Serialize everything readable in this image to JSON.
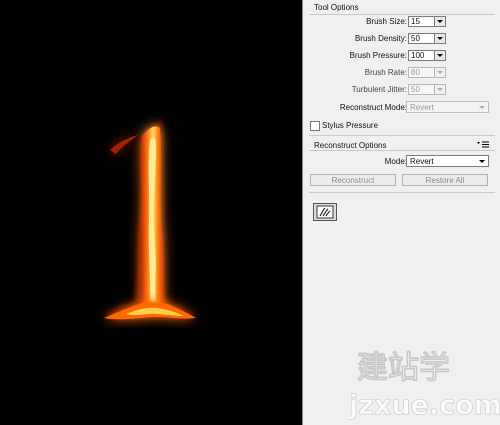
{
  "tool_options": {
    "title": "Tool Options",
    "brush_size": {
      "label": "Brush Size:",
      "value": "15"
    },
    "brush_density": {
      "label": "Brush Density:",
      "value": "50"
    },
    "brush_pressure": {
      "label": "Brush Pressure:",
      "value": "100"
    },
    "brush_rate": {
      "label": "Brush Rate:",
      "value": "80"
    },
    "turbulent_jitter": {
      "label": "Turbulent Jitter:",
      "value": "50"
    },
    "reconstruct_mode": {
      "label": "Reconstruct Mode:",
      "value": "Revert"
    },
    "stylus_pressure": {
      "label": "Stylus Pressure",
      "checked": false
    }
  },
  "reconstruct_options": {
    "title": "Reconstruct Options",
    "mode": {
      "label": "Mode:",
      "value": "Revert"
    },
    "reconstruct_label": "Reconstruct",
    "restore_all_label": "Restore All"
  },
  "canvas": {
    "subject": "flaming numeral one",
    "glyph": "1"
  },
  "watermark": {
    "chinese": "建站学",
    "domain": "jzxue.com"
  },
  "icons": {
    "panel_menu": "panel-menu-icon",
    "tool": "warp-hand-icon"
  },
  "colors": {
    "canvas_bg": "#000000",
    "panel_bg": "#f0f0f0",
    "fire_core": "#ffd84a",
    "fire_edge": "#ff4a00"
  }
}
